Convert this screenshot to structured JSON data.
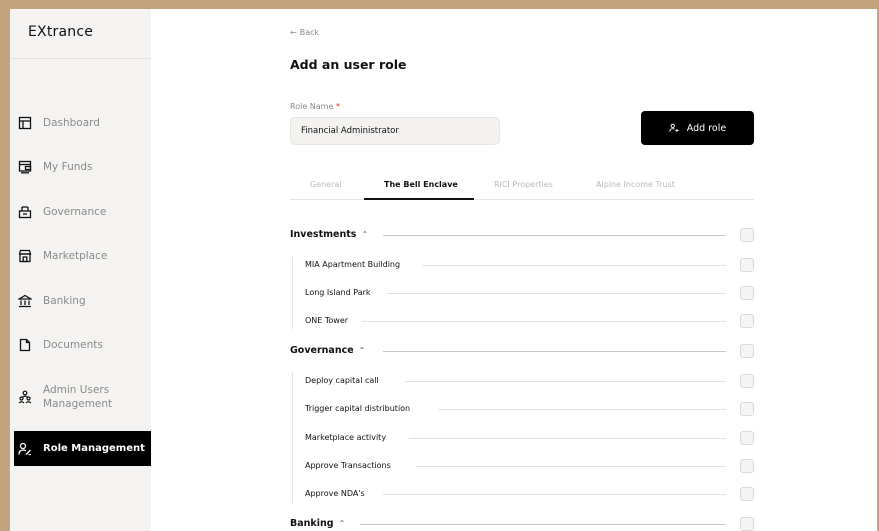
{
  "app": {
    "logo": "EXtrance"
  },
  "sidebar": {
    "items": [
      {
        "label": "Dashboard",
        "icon": "dashboard-icon"
      },
      {
        "label": "My Funds",
        "icon": "funds-icon"
      },
      {
        "label": "Governance",
        "icon": "governance-icon"
      },
      {
        "label": "Marketplace",
        "icon": "marketplace-icon"
      },
      {
        "label": "Banking",
        "icon": "bank-icon"
      },
      {
        "label": "Documents",
        "icon": "document-icon"
      },
      {
        "label": "Admin Users",
        "label2": "Management",
        "icon": "admin-users-icon"
      },
      {
        "label": "Role Management",
        "icon": "role-icon",
        "active": true
      }
    ]
  },
  "header": {
    "back": "Back",
    "title": "Add an user role"
  },
  "form": {
    "role_name_label": "Role Name",
    "required_mark": "*",
    "role_name_value": "Financial Administrator",
    "add_role_label": "Add role"
  },
  "tabs": [
    "General",
    "The Bell Enclave",
    "RICI Properties",
    "Alpine Income Trust"
  ],
  "active_tab": "The Bell Enclave",
  "sections": [
    {
      "title": "Investments",
      "items": [
        "MIA Apartment Building",
        "Long Island Park",
        "ONE Tower"
      ]
    },
    {
      "title": "Governance",
      "items": [
        "Deploy capital call",
        "Trigger capital distribution",
        "Marketplace activity",
        "Approve Transactions",
        "Approve NDA's"
      ]
    },
    {
      "title": "Banking",
      "items": []
    }
  ],
  "colors": {
    "accent": "#000000",
    "frame": "#c2a47e",
    "sidebar_bg": "#f4f3f1",
    "required": "#e02424"
  }
}
